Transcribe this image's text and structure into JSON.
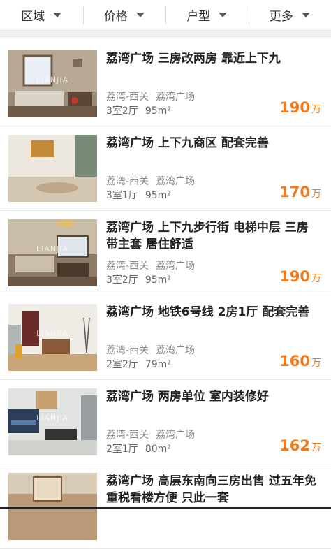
{
  "filters": [
    "区域",
    "价格",
    "户型",
    "更多"
  ],
  "listings": [
    {
      "title": "荔湾广场 三房改两房 靠近上下九",
      "district": "荔湾-西关",
      "community": "荔湾广场",
      "layout": "3室2厅",
      "area": "95m²",
      "price": "190",
      "unit": "万",
      "watermark": "LIANJIA"
    },
    {
      "title": "荔湾广场 上下九商区 配套完善",
      "district": "荔湾-西关",
      "community": "荔湾广场",
      "layout": "3室1厅",
      "area": "95m²",
      "price": "170",
      "unit": "万",
      "watermark": ""
    },
    {
      "title": "荔湾广场 上下九步行街 电梯中层 三房带主套 居住舒适",
      "district": "荔湾-西关",
      "community": "荔湾广场",
      "layout": "3室2厅",
      "area": "95m²",
      "price": "190",
      "unit": "万",
      "watermark": "LIANJIA"
    },
    {
      "title": "荔湾广场 地铁6号线 2房1厅 配套完善",
      "district": "荔湾-西关",
      "community": "荔湾广场",
      "layout": "2室2厅",
      "area": "79m²",
      "price": "160",
      "unit": "万",
      "watermark": "LIANJIA"
    },
    {
      "title": "荔湾广场 两房单位 室内装修好",
      "district": "荔湾-西关",
      "community": "荔湾广场",
      "layout": "2室1厅",
      "area": "80m²",
      "price": "162",
      "unit": "万",
      "watermark": "LIANJIA"
    },
    {
      "title": "荔湾广场 高层东南向三房出售 过五年免重税看楼方便 只此一套",
      "district": "",
      "community": "",
      "layout": "",
      "area": "",
      "price": "",
      "unit": "",
      "watermark": ""
    }
  ]
}
